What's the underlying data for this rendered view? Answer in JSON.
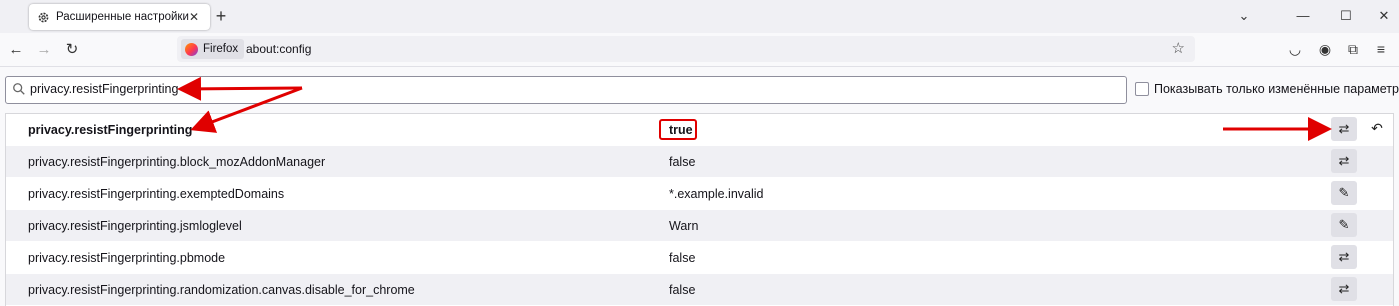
{
  "tab": {
    "title": "Расширенные настройки"
  },
  "navbar": {
    "identity_label": "Firefox",
    "url": "about:config"
  },
  "search": {
    "value": "privacy.resistFingerprinting"
  },
  "filter": {
    "label": "Показывать только изменённые параметры",
    "checked": false
  },
  "prefs": [
    {
      "name": "privacy.resistFingerprinting",
      "value": "true",
      "modified": true,
      "action": "toggle"
    },
    {
      "name": "privacy.resistFingerprinting.block_mozAddonManager",
      "value": "false",
      "modified": false,
      "action": "toggle"
    },
    {
      "name": "privacy.resistFingerprinting.exemptedDomains",
      "value": "*.example.invalid",
      "modified": false,
      "action": "edit"
    },
    {
      "name": "privacy.resistFingerprinting.jsmloglevel",
      "value": "Warn",
      "modified": false,
      "action": "edit"
    },
    {
      "name": "privacy.resistFingerprinting.pbmode",
      "value": "false",
      "modified": false,
      "action": "toggle"
    },
    {
      "name": "privacy.resistFingerprinting.randomization.canvas.disable_for_chrome",
      "value": "false",
      "modified": false,
      "action": "toggle"
    }
  ],
  "colors": {
    "annotation": "#e00000",
    "accent": "#0060df"
  }
}
